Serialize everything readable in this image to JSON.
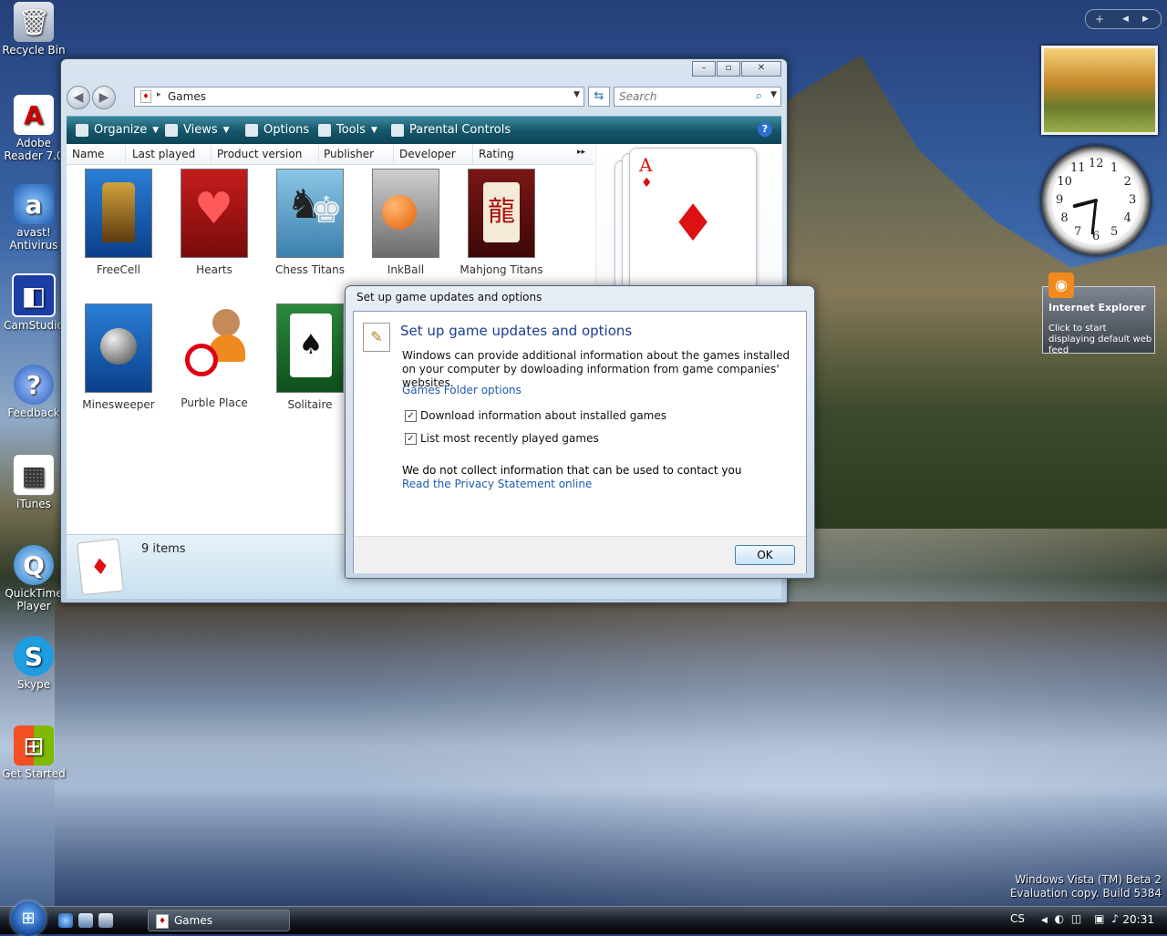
{
  "desktop": {
    "icons": [
      {
        "label": "Recycle Bin",
        "icon": "recycle-bin-icon",
        "glyph": "🗑"
      },
      {
        "label": "Adobe Reader 7.0",
        "icon": "adobe-reader-icon",
        "glyph": "A"
      },
      {
        "label": "avast! Antivirus",
        "icon": "avast-icon",
        "glyph": "a"
      },
      {
        "label": "CamStudio",
        "icon": "camstudio-icon",
        "glyph": "◧"
      },
      {
        "label": "Feedback",
        "icon": "feedback-icon",
        "glyph": "?"
      },
      {
        "label": "iTunes",
        "icon": "itunes-icon",
        "glyph": "▦"
      },
      {
        "label": "QuickTime Player",
        "icon": "quicktime-icon",
        "glyph": "Q"
      },
      {
        "label": "Skype",
        "icon": "skype-icon",
        "glyph": "S"
      },
      {
        "label": "Get Started",
        "icon": "windows-flag-icon",
        "glyph": "⊞"
      }
    ],
    "watermark": {
      "line1": "Windows Vista (TM) Beta 2",
      "line2": "Evaluation copy. Build 5384"
    }
  },
  "explorer": {
    "address": "Games",
    "search_placeholder": "Search",
    "toolbar": {
      "organize": "Organize",
      "views": "Views",
      "options": "Options",
      "tools": "Tools",
      "parental": "Parental Controls",
      "help": "?"
    },
    "columns": [
      "Name",
      "Last played",
      "Product version",
      "Publisher",
      "Developer",
      "Rating"
    ],
    "games": [
      {
        "label": "FreeCell",
        "icon": "freecell-icon"
      },
      {
        "label": "Hearts",
        "icon": "hearts-icon"
      },
      {
        "label": "Chess Titans",
        "icon": "chess-titans-icon"
      },
      {
        "label": "InkBall",
        "icon": "inkball-icon"
      },
      {
        "label": "Mahjong Titans",
        "icon": "mahjong-titans-icon"
      },
      {
        "label": "Minesweeper",
        "icon": "minesweeper-icon"
      },
      {
        "label": "Purble Place",
        "icon": "purble-place-icon"
      },
      {
        "label": "Solitaire",
        "icon": "solitaire-icon"
      }
    ],
    "preview_card": {
      "rank": "A",
      "suit": "♦"
    },
    "status": "9 items"
  },
  "dialog": {
    "title": "Set up game updates and options",
    "heading": "Set up game updates and options",
    "description": "Windows can provide additional information about the games installed on your computer by dowloading information from game companies' websites.",
    "folder_link": "Games Folder options",
    "checkbox1": "Download information about installed games",
    "checkbox2": "List most recently played games",
    "privacy_text": "We do not collect information that can be used to contact you",
    "privacy_link": "Read the Privacy Statement online",
    "ok": "OK"
  },
  "sidebar": {
    "clock": {
      "hour": 8,
      "minute": 31
    },
    "clock_numbers": [
      "12",
      "1",
      "2",
      "3",
      "4",
      "5",
      "6",
      "7",
      "8",
      "9",
      "10",
      "11"
    ],
    "rss_title": "Internet Explorer",
    "rss_message": "Click to start displaying default web feed"
  },
  "taskbar": {
    "task_label": "Games",
    "lang": "CS",
    "time": "20:31"
  }
}
